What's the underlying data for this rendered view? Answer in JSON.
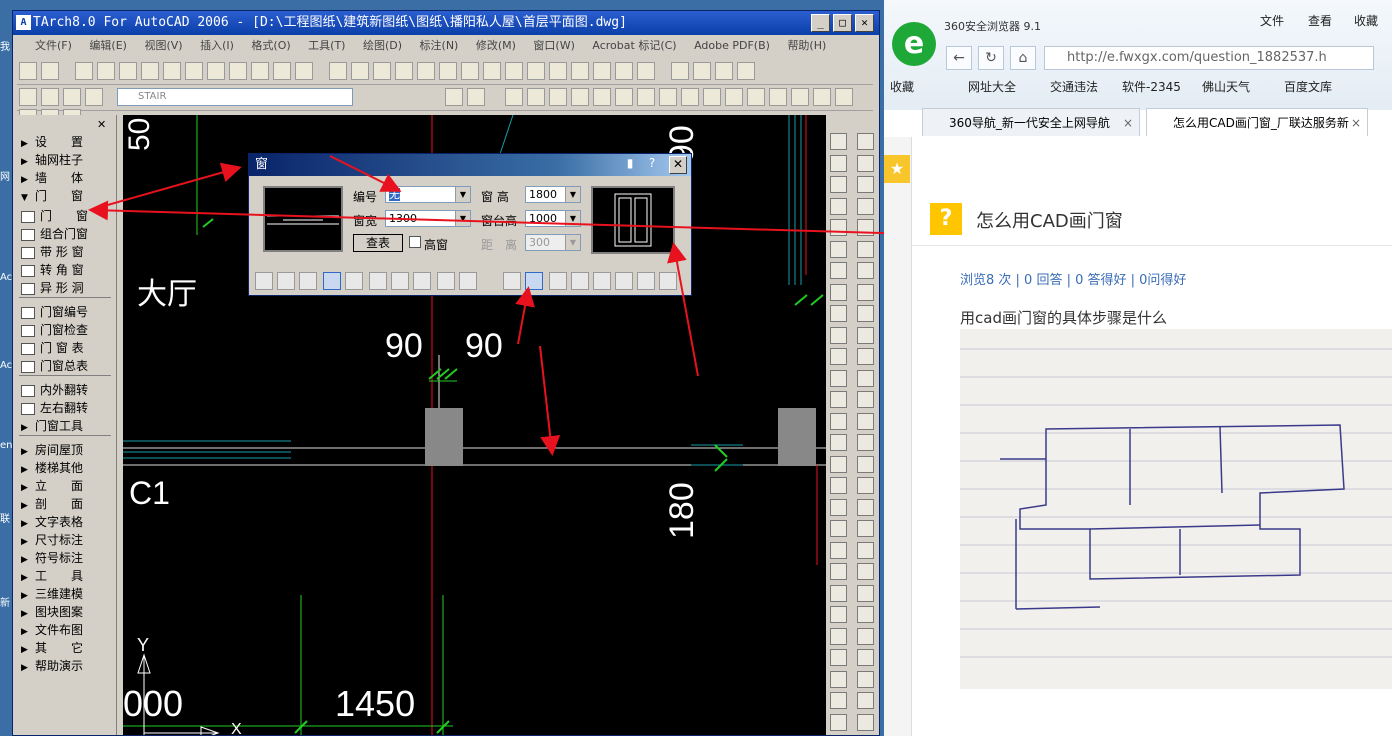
{
  "desktop": {
    "strip_labels": [
      "我",
      "网",
      "Ac",
      "Ac",
      "en",
      "联",
      "新"
    ]
  },
  "cad": {
    "title": "TArch8.0 For AutoCAD 2006 - [D:\\工程图纸\\建筑新图纸\\图纸\\播阳私人屋\\首层平面图.dwg]",
    "window_controls": {
      "min": "_",
      "max": "□",
      "close": "✕"
    },
    "menu": [
      "文件(F)",
      "编辑(E)",
      "视图(V)",
      "插入(I)",
      "格式(O)",
      "工具(T)",
      "绘图(D)",
      "标注(N)",
      "修改(M)",
      "窗口(W)",
      "Acrobat 标记(C)",
      "Adobe PDF(B)",
      "帮助(H)"
    ],
    "layer": "STAIR",
    "left_menu": {
      "close": "✕",
      "items": [
        {
          "label": "设　　置",
          "type": "arrow"
        },
        {
          "label": "轴网柱子",
          "type": "arrow"
        },
        {
          "label": "墙　　体",
          "type": "arrow"
        },
        {
          "label": "门　　窗",
          "type": "arrow-down"
        },
        {
          "label": "门　　窗",
          "type": "icon"
        },
        {
          "label": "组合门窗",
          "type": "icon"
        },
        {
          "label": "带 形 窗",
          "type": "icon"
        },
        {
          "label": "转 角 窗",
          "type": "icon"
        },
        {
          "label": "异 形 洞",
          "type": "icon"
        },
        {
          "label": "门窗编号",
          "type": "icon"
        },
        {
          "label": "门窗检查",
          "type": "icon"
        },
        {
          "label": "门 窗 表",
          "type": "icon"
        },
        {
          "label": "门窗总表",
          "type": "icon"
        },
        {
          "label": "内外翻转",
          "type": "icon"
        },
        {
          "label": "左右翻转",
          "type": "icon"
        },
        {
          "label": "门窗工具",
          "type": "arrow"
        },
        {
          "label": "房间屋顶",
          "type": "arrow"
        },
        {
          "label": "楼梯其他",
          "type": "arrow"
        },
        {
          "label": "立　　面",
          "type": "arrow"
        },
        {
          "label": "剖　　面",
          "type": "arrow"
        },
        {
          "label": "文字表格",
          "type": "arrow"
        },
        {
          "label": "尺寸标注",
          "type": "arrow"
        },
        {
          "label": "符号标注",
          "type": "arrow"
        },
        {
          "label": "工　　具",
          "type": "arrow"
        },
        {
          "label": "三维建模",
          "type": "arrow"
        },
        {
          "label": "图块图案",
          "type": "arrow"
        },
        {
          "label": "文件布图",
          "type": "arrow"
        },
        {
          "label": "其　　它",
          "type": "arrow"
        },
        {
          "label": "帮助演示",
          "type": "arrow"
        }
      ]
    },
    "drawing": {
      "room_label": "大厅",
      "label_c1": "C1",
      "dim_90a": "90",
      "dim_90b": "90",
      "dim_180": "180",
      "dim_1450": "1450",
      "dim_000": "000",
      "dim_top_2": "2",
      "dim_top_90": "90",
      "dim_top_50": "50",
      "axis_y": "Y",
      "axis_x": "X"
    },
    "dialog": {
      "title": "窗",
      "pin": "▮",
      "help": "?",
      "close": "✕",
      "label_number": "编号",
      "number_value": "无",
      "label_height": "窗 高",
      "height_value": "1800",
      "label_width": "窗宽",
      "width_value": "1300",
      "label_sill": "窗台高",
      "sill_value": "1000",
      "query_button": "查表",
      "high_window": "高窗",
      "label_distance": "距　离",
      "distance_value": "300"
    }
  },
  "browser": {
    "app_name": "360安全浏览器 9.1",
    "menu": [
      "文件",
      "查看",
      "收藏"
    ],
    "address": "http://e.fwxgx.com/question_1882537.h",
    "favorites": [
      "收藏",
      "网址大全",
      "交通违法",
      "软件-2345",
      "佛山天气",
      "百度文库"
    ],
    "tabs": [
      {
        "label": "360导航_新一代安全上网导航",
        "active": false
      },
      {
        "label": "怎么用CAD画门窗_厂联达服务新",
        "active": true
      }
    ],
    "question": {
      "title": "怎么用CAD画门窗",
      "stats": "浏览8 次 | 0 回答 | 0 答得好 | 0问得好",
      "description": "用cad画门窗的具体步骤是什么"
    }
  },
  "colors": {
    "cad_bg": "#000000",
    "dialog_title": "#0a246a",
    "arrow": "#e8121e",
    "green_line": "#22cc22",
    "browser_accent": "#1ea838"
  }
}
